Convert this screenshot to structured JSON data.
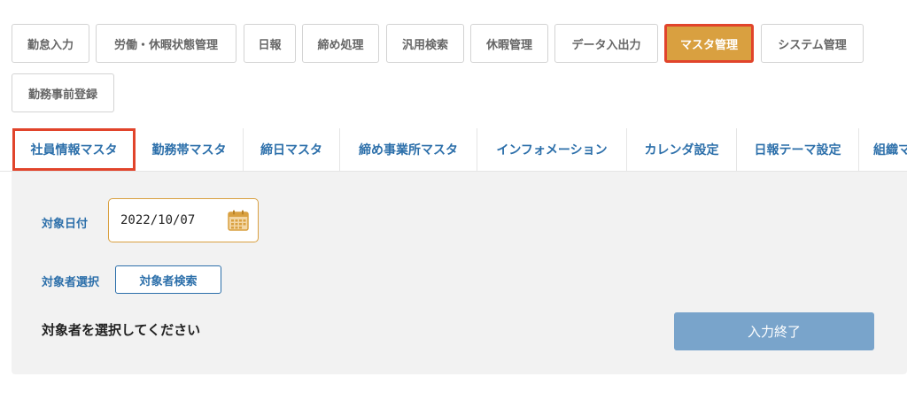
{
  "top_nav": [
    {
      "label": "勤怠入力"
    },
    {
      "label": "労働・休暇状態管理"
    },
    {
      "label": "日報"
    },
    {
      "label": "締め処理"
    },
    {
      "label": "汎用検索"
    },
    {
      "label": "休暇管理"
    },
    {
      "label": "データ入出力"
    },
    {
      "label": "マスタ管理",
      "active": true
    },
    {
      "label": "システム管理"
    },
    {
      "label": "勤務事前登録"
    }
  ],
  "sub_tabs": [
    {
      "label": "社員情報マスタ",
      "active": true
    },
    {
      "label": "勤務帯マスタ"
    },
    {
      "label": "締日マスタ"
    },
    {
      "label": "締め事業所マスタ"
    },
    {
      "label": "インフォメーション"
    },
    {
      "label": "カレンダ設定"
    },
    {
      "label": "日報テーマ設定"
    },
    {
      "label": "組織マ"
    }
  ],
  "form": {
    "date_label": "対象日付",
    "date_value": "2022/10/07",
    "calendar_icon": "calendar-icon",
    "target_label": "対象者選択",
    "search_button": "対象者検索",
    "message": "対象者を選択してください",
    "finish_button": "入力終了"
  },
  "colors": {
    "accent_orange": "#d9a040",
    "highlight_red": "#e1442b",
    "link_blue": "#2c6faa",
    "button_blue": "#79a4cb",
    "panel_bg": "#f2f2f2"
  }
}
